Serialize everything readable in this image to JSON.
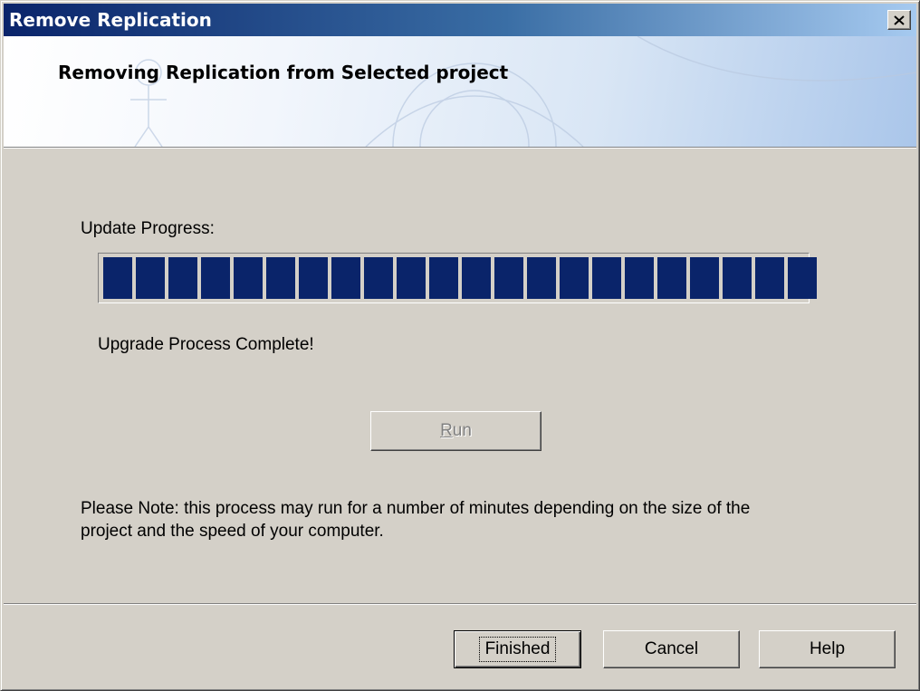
{
  "window": {
    "title": "Remove Replication",
    "close_icon": "close-icon"
  },
  "header": {
    "heading": "Removing Replication from Selected project"
  },
  "progress": {
    "label": "Update Progress:",
    "percent": 100,
    "block_count": 22,
    "status": "Upgrade Process Complete!",
    "fill_color": "#0a246a"
  },
  "buttons": {
    "run": {
      "label": "Run",
      "mnemonic": "R",
      "rest": "un",
      "enabled": false
    },
    "finished": "Finished",
    "cancel": "Cancel",
    "help": "Help"
  },
  "note": {
    "line1": "Please Note: this process may run for a number of minutes depending on the size of the",
    "line2": "project and the speed of your computer."
  }
}
